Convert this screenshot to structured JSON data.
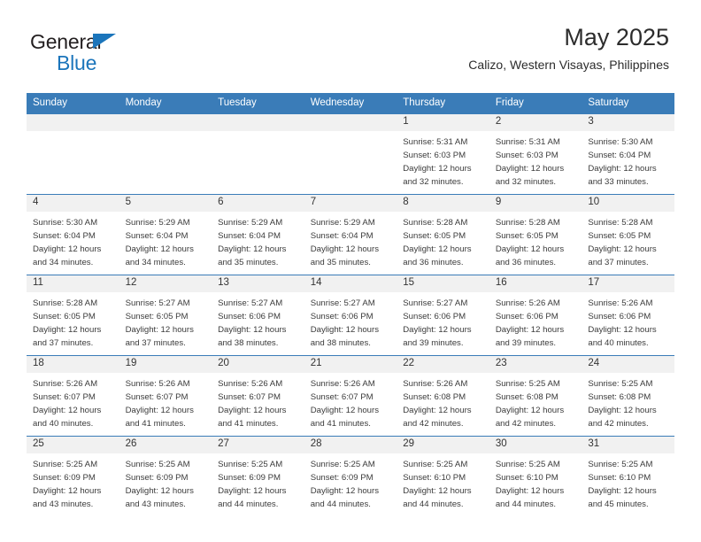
{
  "brand": {
    "line1": "General",
    "line2": "Blue",
    "triangle_icon": "blue-triangle-icon",
    "colors": {
      "text": "#231f20",
      "accent": "#1b75bb"
    }
  },
  "header": {
    "month_title": "May 2025",
    "location": "Calizo, Western Visayas, Philippines"
  },
  "colors": {
    "header_blue": "#3a7cb8",
    "daynum_band": "#f1f1f1",
    "body_text": "#3b3b3b"
  },
  "calendar": {
    "weekday_headers": [
      "Sunday",
      "Monday",
      "Tuesday",
      "Wednesday",
      "Thursday",
      "Friday",
      "Saturday"
    ],
    "weeks": [
      [
        {
          "day": "",
          "sunrise": "",
          "sunset": "",
          "daylight_line1": "",
          "daylight_line2": ""
        },
        {
          "day": "",
          "sunrise": "",
          "sunset": "",
          "daylight_line1": "",
          "daylight_line2": ""
        },
        {
          "day": "",
          "sunrise": "",
          "sunset": "",
          "daylight_line1": "",
          "daylight_line2": ""
        },
        {
          "day": "",
          "sunrise": "",
          "sunset": "",
          "daylight_line1": "",
          "daylight_line2": ""
        },
        {
          "day": "1",
          "sunrise": "Sunrise: 5:31 AM",
          "sunset": "Sunset: 6:03 PM",
          "daylight_line1": "Daylight: 12 hours",
          "daylight_line2": "and 32 minutes."
        },
        {
          "day": "2",
          "sunrise": "Sunrise: 5:31 AM",
          "sunset": "Sunset: 6:03 PM",
          "daylight_line1": "Daylight: 12 hours",
          "daylight_line2": "and 32 minutes."
        },
        {
          "day": "3",
          "sunrise": "Sunrise: 5:30 AM",
          "sunset": "Sunset: 6:04 PM",
          "daylight_line1": "Daylight: 12 hours",
          "daylight_line2": "and 33 minutes."
        }
      ],
      [
        {
          "day": "4",
          "sunrise": "Sunrise: 5:30 AM",
          "sunset": "Sunset: 6:04 PM",
          "daylight_line1": "Daylight: 12 hours",
          "daylight_line2": "and 34 minutes."
        },
        {
          "day": "5",
          "sunrise": "Sunrise: 5:29 AM",
          "sunset": "Sunset: 6:04 PM",
          "daylight_line1": "Daylight: 12 hours",
          "daylight_line2": "and 34 minutes."
        },
        {
          "day": "6",
          "sunrise": "Sunrise: 5:29 AM",
          "sunset": "Sunset: 6:04 PM",
          "daylight_line1": "Daylight: 12 hours",
          "daylight_line2": "and 35 minutes."
        },
        {
          "day": "7",
          "sunrise": "Sunrise: 5:29 AM",
          "sunset": "Sunset: 6:04 PM",
          "daylight_line1": "Daylight: 12 hours",
          "daylight_line2": "and 35 minutes."
        },
        {
          "day": "8",
          "sunrise": "Sunrise: 5:28 AM",
          "sunset": "Sunset: 6:05 PM",
          "daylight_line1": "Daylight: 12 hours",
          "daylight_line2": "and 36 minutes."
        },
        {
          "day": "9",
          "sunrise": "Sunrise: 5:28 AM",
          "sunset": "Sunset: 6:05 PM",
          "daylight_line1": "Daylight: 12 hours",
          "daylight_line2": "and 36 minutes."
        },
        {
          "day": "10",
          "sunrise": "Sunrise: 5:28 AM",
          "sunset": "Sunset: 6:05 PM",
          "daylight_line1": "Daylight: 12 hours",
          "daylight_line2": "and 37 minutes."
        }
      ],
      [
        {
          "day": "11",
          "sunrise": "Sunrise: 5:28 AM",
          "sunset": "Sunset: 6:05 PM",
          "daylight_line1": "Daylight: 12 hours",
          "daylight_line2": "and 37 minutes."
        },
        {
          "day": "12",
          "sunrise": "Sunrise: 5:27 AM",
          "sunset": "Sunset: 6:05 PM",
          "daylight_line1": "Daylight: 12 hours",
          "daylight_line2": "and 37 minutes."
        },
        {
          "day": "13",
          "sunrise": "Sunrise: 5:27 AM",
          "sunset": "Sunset: 6:06 PM",
          "daylight_line1": "Daylight: 12 hours",
          "daylight_line2": "and 38 minutes."
        },
        {
          "day": "14",
          "sunrise": "Sunrise: 5:27 AM",
          "sunset": "Sunset: 6:06 PM",
          "daylight_line1": "Daylight: 12 hours",
          "daylight_line2": "and 38 minutes."
        },
        {
          "day": "15",
          "sunrise": "Sunrise: 5:27 AM",
          "sunset": "Sunset: 6:06 PM",
          "daylight_line1": "Daylight: 12 hours",
          "daylight_line2": "and 39 minutes."
        },
        {
          "day": "16",
          "sunrise": "Sunrise: 5:26 AM",
          "sunset": "Sunset: 6:06 PM",
          "daylight_line1": "Daylight: 12 hours",
          "daylight_line2": "and 39 minutes."
        },
        {
          "day": "17",
          "sunrise": "Sunrise: 5:26 AM",
          "sunset": "Sunset: 6:06 PM",
          "daylight_line1": "Daylight: 12 hours",
          "daylight_line2": "and 40 minutes."
        }
      ],
      [
        {
          "day": "18",
          "sunrise": "Sunrise: 5:26 AM",
          "sunset": "Sunset: 6:07 PM",
          "daylight_line1": "Daylight: 12 hours",
          "daylight_line2": "and 40 minutes."
        },
        {
          "day": "19",
          "sunrise": "Sunrise: 5:26 AM",
          "sunset": "Sunset: 6:07 PM",
          "daylight_line1": "Daylight: 12 hours",
          "daylight_line2": "and 41 minutes."
        },
        {
          "day": "20",
          "sunrise": "Sunrise: 5:26 AM",
          "sunset": "Sunset: 6:07 PM",
          "daylight_line1": "Daylight: 12 hours",
          "daylight_line2": "and 41 minutes."
        },
        {
          "day": "21",
          "sunrise": "Sunrise: 5:26 AM",
          "sunset": "Sunset: 6:07 PM",
          "daylight_line1": "Daylight: 12 hours",
          "daylight_line2": "and 41 minutes."
        },
        {
          "day": "22",
          "sunrise": "Sunrise: 5:26 AM",
          "sunset": "Sunset: 6:08 PM",
          "daylight_line1": "Daylight: 12 hours",
          "daylight_line2": "and 42 minutes."
        },
        {
          "day": "23",
          "sunrise": "Sunrise: 5:25 AM",
          "sunset": "Sunset: 6:08 PM",
          "daylight_line1": "Daylight: 12 hours",
          "daylight_line2": "and 42 minutes."
        },
        {
          "day": "24",
          "sunrise": "Sunrise: 5:25 AM",
          "sunset": "Sunset: 6:08 PM",
          "daylight_line1": "Daylight: 12 hours",
          "daylight_line2": "and 42 minutes."
        }
      ],
      [
        {
          "day": "25",
          "sunrise": "Sunrise: 5:25 AM",
          "sunset": "Sunset: 6:09 PM",
          "daylight_line1": "Daylight: 12 hours",
          "daylight_line2": "and 43 minutes."
        },
        {
          "day": "26",
          "sunrise": "Sunrise: 5:25 AM",
          "sunset": "Sunset: 6:09 PM",
          "daylight_line1": "Daylight: 12 hours",
          "daylight_line2": "and 43 minutes."
        },
        {
          "day": "27",
          "sunrise": "Sunrise: 5:25 AM",
          "sunset": "Sunset: 6:09 PM",
          "daylight_line1": "Daylight: 12 hours",
          "daylight_line2": "and 44 minutes."
        },
        {
          "day": "28",
          "sunrise": "Sunrise: 5:25 AM",
          "sunset": "Sunset: 6:09 PM",
          "daylight_line1": "Daylight: 12 hours",
          "daylight_line2": "and 44 minutes."
        },
        {
          "day": "29",
          "sunrise": "Sunrise: 5:25 AM",
          "sunset": "Sunset: 6:10 PM",
          "daylight_line1": "Daylight: 12 hours",
          "daylight_line2": "and 44 minutes."
        },
        {
          "day": "30",
          "sunrise": "Sunrise: 5:25 AM",
          "sunset": "Sunset: 6:10 PM",
          "daylight_line1": "Daylight: 12 hours",
          "daylight_line2": "and 44 minutes."
        },
        {
          "day": "31",
          "sunrise": "Sunrise: 5:25 AM",
          "sunset": "Sunset: 6:10 PM",
          "daylight_line1": "Daylight: 12 hours",
          "daylight_line2": "and 45 minutes."
        }
      ]
    ]
  }
}
